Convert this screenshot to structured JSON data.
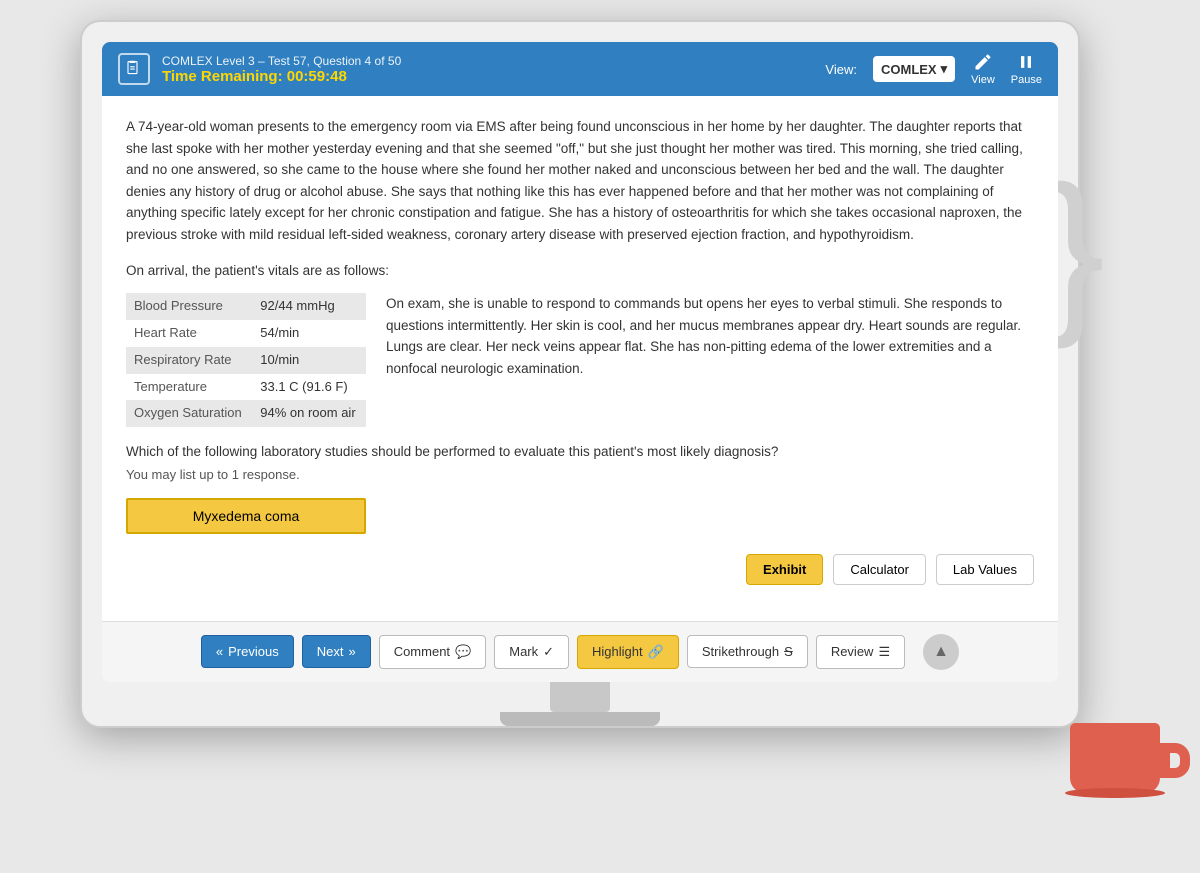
{
  "header": {
    "icon_label": "📋",
    "test_info": "COMLEX Level 3 – Test 57, Question 4 of 50",
    "time_remaining": "Time Remaining: 00:59:48",
    "view_label": "View:",
    "view_option": "COMLEX",
    "view_btn_label": "View",
    "pause_btn_label": "Pause"
  },
  "content": {
    "case_text": "A 74-year-old woman presents to the emergency room via EMS after being found unconscious in her home by her daughter. The daughter reports that she last spoke with her mother yesterday evening and that she seemed \"off,\" but she just thought her mother was tired. This morning, she tried calling, and no one answered, so she came to the house where she found her mother naked and unconscious between her bed and the wall. The daughter denies any history of drug or alcohol abuse. She says that nothing like this has ever happened before and that her mother was not complaining of anything specific lately except for her chronic constipation and fatigue. She has a history of osteoarthritis for which she takes occasional naproxen, the previous stroke with mild residual left-sided weakness, coronary artery disease with preserved ejection fraction, and hypothyroidism.",
    "vitals_intro": "On arrival, the patient's vitals are as follows:",
    "vitals": [
      {
        "label": "Blood Pressure",
        "value": "92/44 mmHg"
      },
      {
        "label": "Heart Rate",
        "value": "54/min"
      },
      {
        "label": "Respiratory Rate",
        "value": "10/min"
      },
      {
        "label": "Temperature",
        "value": "33.1 C (91.6 F)"
      },
      {
        "label": "Oxygen Saturation",
        "value": "94% on room air"
      }
    ],
    "exam_text": "On exam, she is unable to respond to commands but opens her eyes to verbal stimuli. She responds to questions intermittently. Her skin is cool, and her mucus membranes appear dry. Heart sounds are regular. Lungs are clear. Her neck veins appear flat. She has non-pitting edema of the lower extremities and a nonfocal neurologic examination.",
    "question_text": "Which of the following laboratory studies should be performed to evaluate this patient's most likely diagnosis?",
    "response_limit": "You may list up to 1 response.",
    "answer_option": "Myxedema coma"
  },
  "tool_buttons": {
    "exhibit": "Exhibit",
    "calculator": "Calculator",
    "lab_values": "Lab Values"
  },
  "nav_buttons": {
    "previous": "« Previous",
    "next": "Next »",
    "comment": "Comment 💬",
    "mark": "Mark ✓",
    "highlight": "Highlight 🔗",
    "strikethrough": "Strikethrough $",
    "review": "Review ☰"
  }
}
